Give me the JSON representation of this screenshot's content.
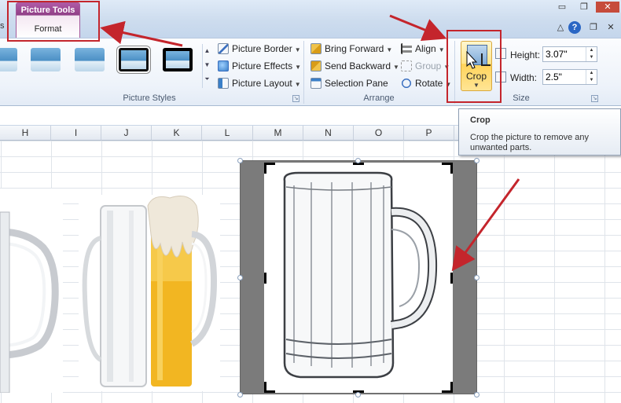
{
  "ribbon_tabs": {
    "left_stub": "s",
    "context_group": "Picture Tools",
    "active_tab": "Format"
  },
  "window_controls": {
    "minimize": "▭",
    "restore": "❐",
    "close": "✕"
  },
  "ribbon_controls": {
    "collapse": "△",
    "help": "?",
    "restore": "❐",
    "close": "✕"
  },
  "picture_styles": {
    "group_label": "Picture Styles",
    "picture_border": "Picture Border",
    "picture_effects": "Picture Effects",
    "picture_layout": "Picture Layout"
  },
  "arrange": {
    "group_label": "Arrange",
    "bring_forward": "Bring Forward",
    "send_backward": "Send Backward",
    "selection_pane": "Selection Pane",
    "align": "Align",
    "group": "Group",
    "rotate": "Rotate"
  },
  "size": {
    "group_label": "Size",
    "crop_label": "Crop",
    "height_label": "Height:",
    "height_value": "3.07\"",
    "width_label": "Width:",
    "width_value": "2.5\""
  },
  "tooltip": {
    "title": "Crop",
    "body": "Crop the picture to remove any unwanted parts."
  },
  "columns": [
    "H",
    "I",
    "J",
    "K",
    "L",
    "M",
    "N",
    "O",
    "P"
  ],
  "colors": {
    "context_tab": "#8f3f86",
    "annotation_red": "#c4252c",
    "crop_button": "#ffd35a",
    "beer": "#f2b622"
  }
}
